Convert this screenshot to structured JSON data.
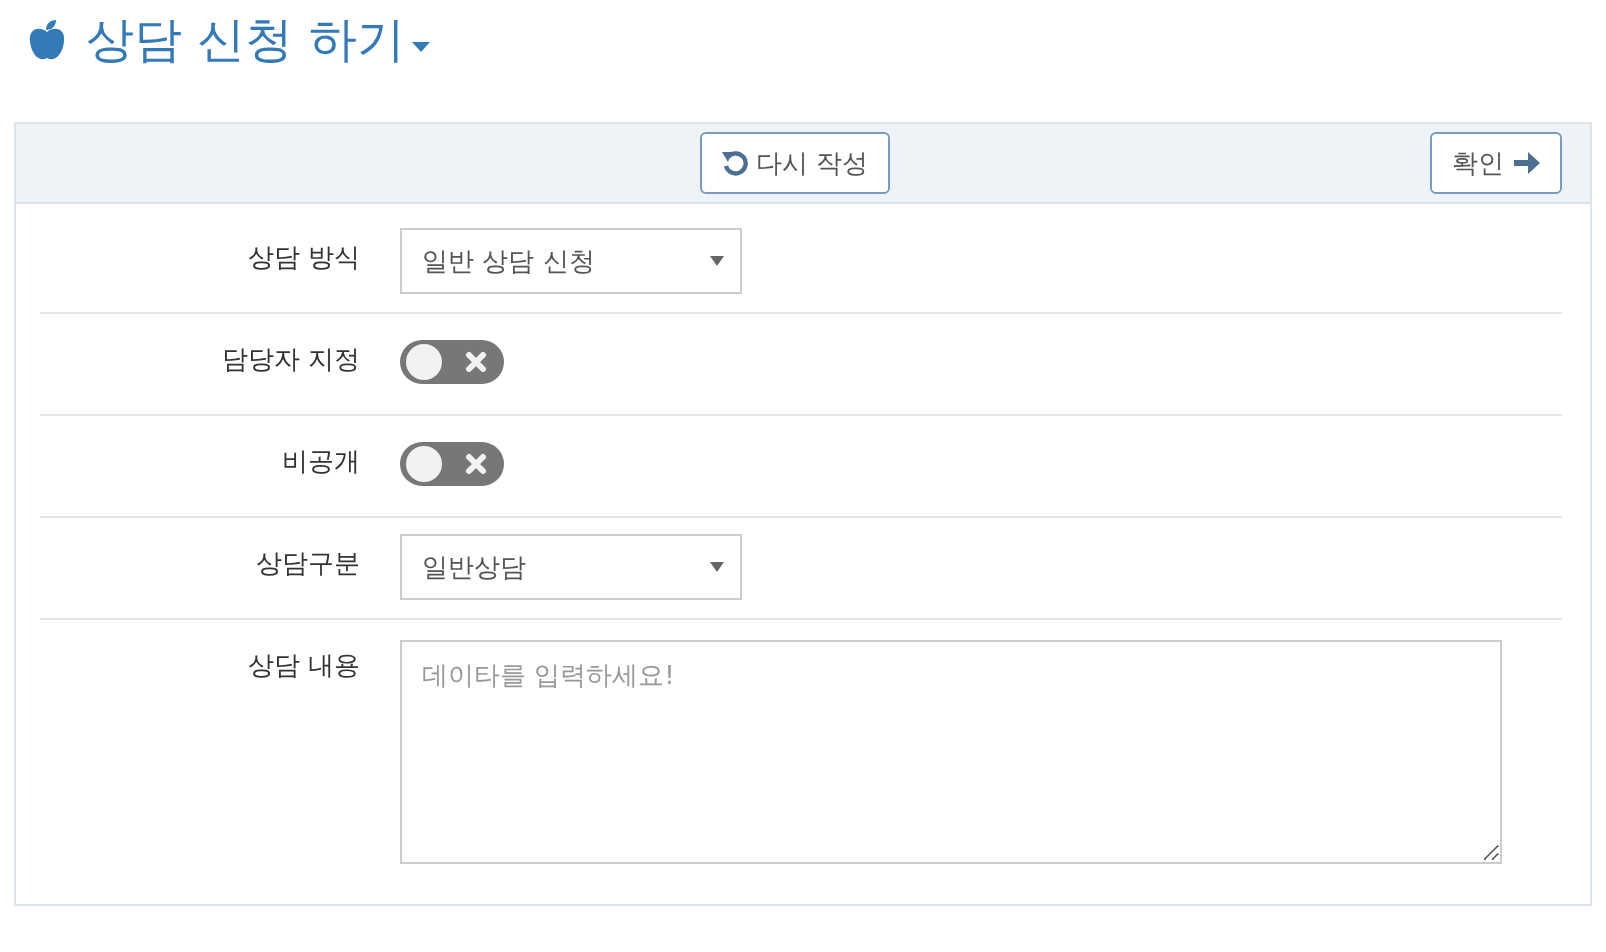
{
  "title": "상담 신청 하기",
  "toolbar": {
    "reset_button": "다시 작성",
    "confirm_button": "확인"
  },
  "fields": [
    {
      "kind": "select",
      "label": "상담 방식",
      "value": "일반 상담 신청"
    },
    {
      "kind": "toggle",
      "label": "담당자 지정",
      "on": false
    },
    {
      "kind": "toggle",
      "label": "비공개",
      "on": false
    },
    {
      "kind": "select",
      "label": "상담구분",
      "value": "일반상담"
    },
    {
      "kind": "textarea",
      "label": "상담 내용",
      "placeholder": "데이타를 입력하세요!"
    }
  ]
}
